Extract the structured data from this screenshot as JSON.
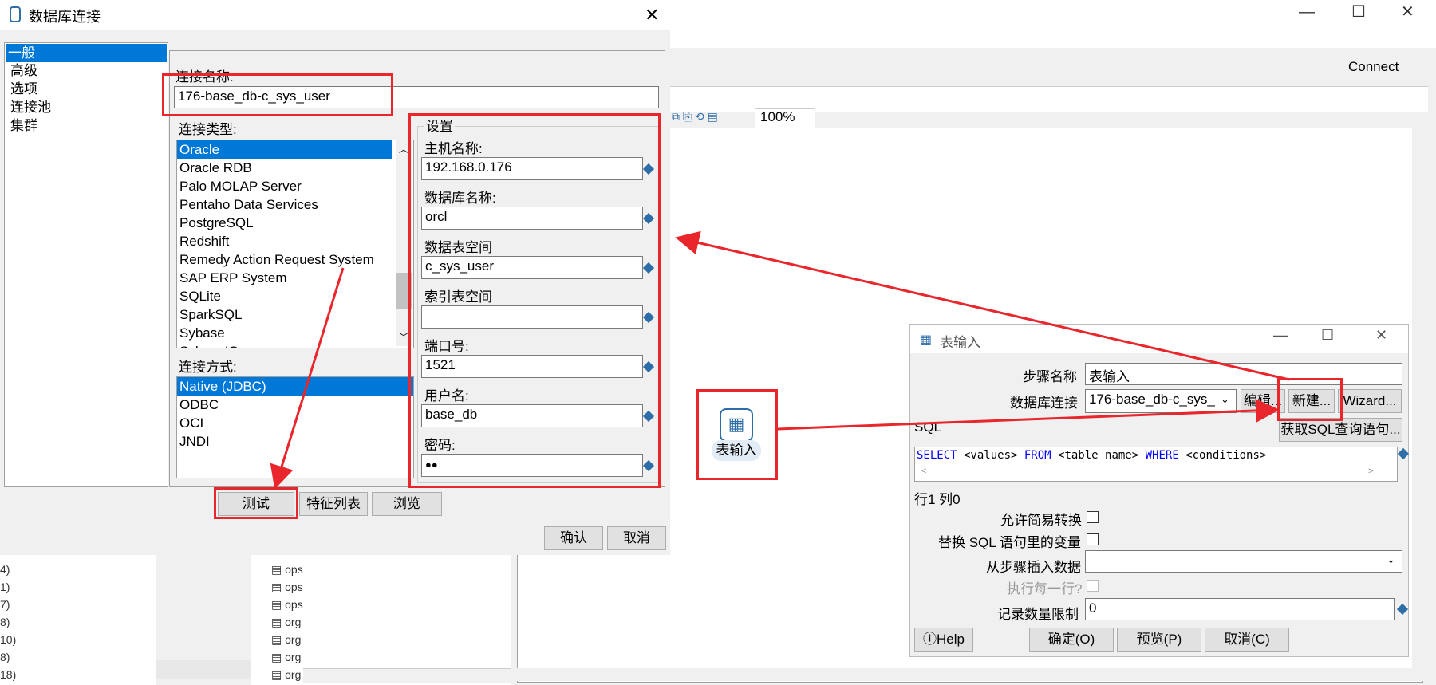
{
  "background": {
    "connect_label": "Connect",
    "zoom": "100%",
    "tree_items": [
      "ops",
      "ops",
      "ops",
      "org",
      "org",
      "org",
      "org"
    ],
    "left_numbers": [
      "4)",
      "1)",
      "7)",
      "8)",
      "10)",
      "8)",
      "18)"
    ]
  },
  "db_dialog": {
    "title": "数据库连接",
    "nav": [
      "一般",
      "高级",
      "选项",
      "连接池",
      "集群"
    ],
    "conn_name_label": "连接名称:",
    "conn_name_value": "176-base_db-c_sys_user",
    "conn_type_label": "连接类型:",
    "conn_types": [
      "Oracle",
      "Oracle RDB",
      "Palo MOLAP Server",
      "Pentaho Data Services",
      "PostgreSQL",
      "Redshift",
      "Remedy Action Request System",
      "SAP ERP System",
      "SQLite",
      "SparkSQL",
      "Sybase",
      "SybaseIQ"
    ],
    "access_label": "连接方式:",
    "access_types": [
      "Native (JDBC)",
      "ODBC",
      "OCI",
      "JNDI"
    ],
    "settings_label": "设置",
    "host_label": "主机名称:",
    "host_value": "192.168.0.176",
    "dbname_label": "数据库名称:",
    "dbname_value": "orcl",
    "tablespace_label": "数据表空间",
    "tablespace_value": "c_sys_user",
    "index_tablespace_label": "索引表空间",
    "index_tablespace_value": "",
    "port_label": "端口号:",
    "port_value": "1521",
    "user_label": "用户名:",
    "user_value": "base_db",
    "password_label": "密码:",
    "password_value": "●●",
    "test_btn": "测试",
    "features_btn": "特征列表",
    "browse_btn": "浏览",
    "ok_btn": "确认",
    "cancel_btn": "取消"
  },
  "canvas": {
    "step_label": "表输入"
  },
  "table_input_dialog": {
    "title": "表输入",
    "step_name_label": "步骤名称",
    "step_name_value": "表输入",
    "db_conn_label": "数据库连接",
    "db_conn_value": "176-base_db-c_sys_",
    "edit_btn": "编辑...",
    "new_btn": "新建...",
    "wizard_btn": "Wizard...",
    "sql_label": "SQL",
    "get_sql_btn": "获取SQL查询语句...",
    "sql": {
      "k1": "SELECT",
      "t1": " <values> ",
      "k2": "FROM",
      "t2": " <table name> ",
      "k3": "WHERE",
      "t3": " <conditions>"
    },
    "position": "行1 列0",
    "lazy_label": "允许简易转换",
    "replace_var_label": "替换 SQL 语句里的变量",
    "insert_from_label": "从步骤插入数据",
    "exec_each_label": "执行每一行?",
    "limit_label": "记录数量限制",
    "limit_value": "0",
    "help_btn": "Help",
    "ok_btn": "确定(O)",
    "preview_btn": "预览(P)",
    "cancel_btn": "取消(C)"
  },
  "colors": {
    "highlight": "#e8262c",
    "selection": "#0078d7"
  }
}
